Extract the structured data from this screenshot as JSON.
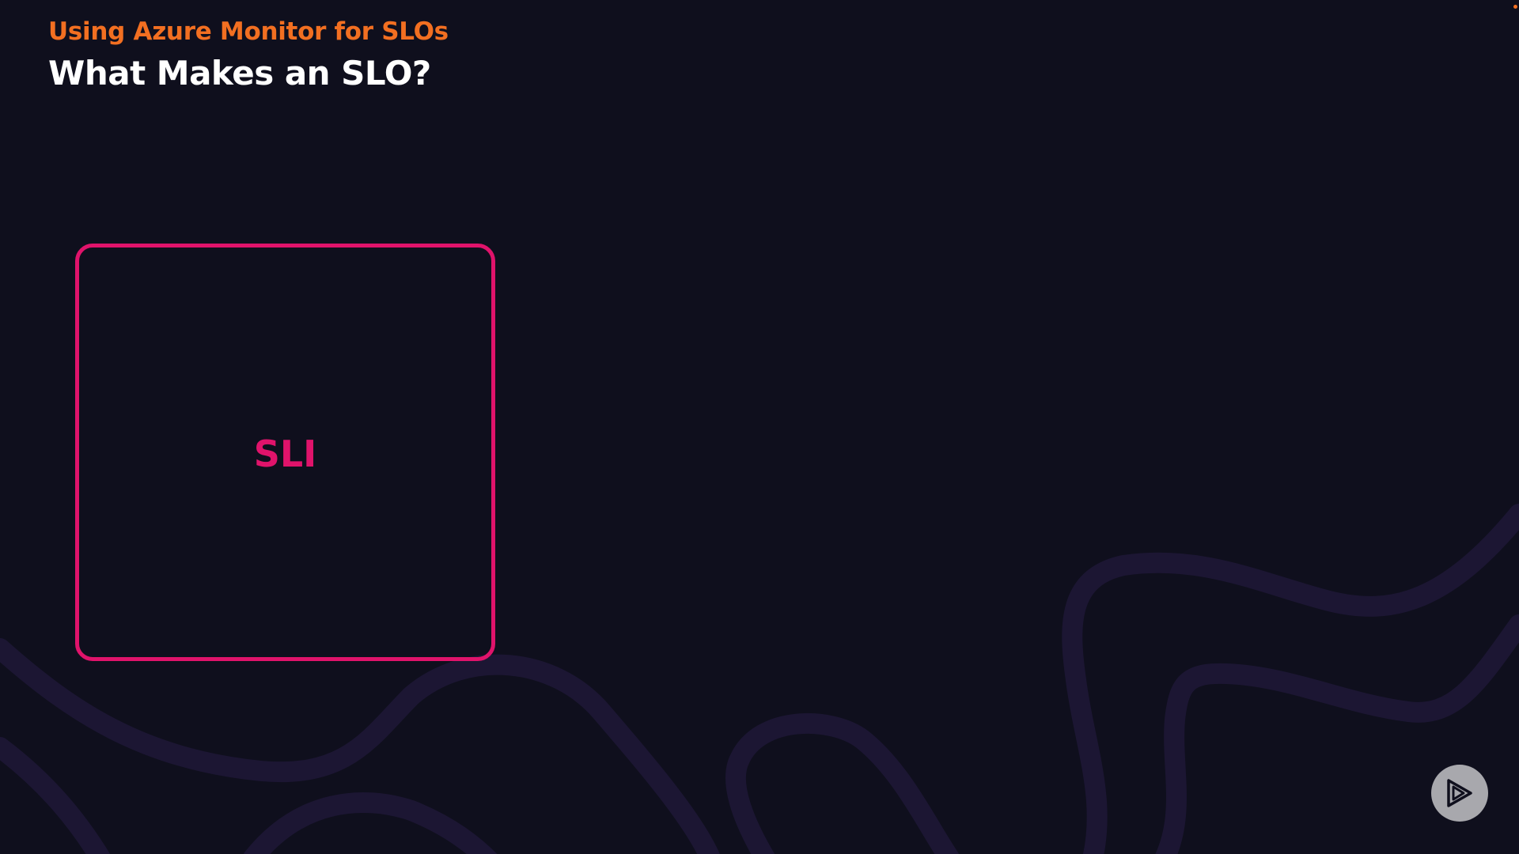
{
  "slide": {
    "course_title": "Using Azure Monitor for SLOs",
    "heading": "What Makes an SLO?",
    "box_label": "SLI"
  },
  "colors": {
    "background": "#0f0f1d",
    "accent_orange": "#f26f21",
    "accent_pink": "#e0136b",
    "wave": "#1c1633",
    "play_button": "#a8a8ad"
  },
  "icons": {
    "player_logo": "play-icon"
  }
}
